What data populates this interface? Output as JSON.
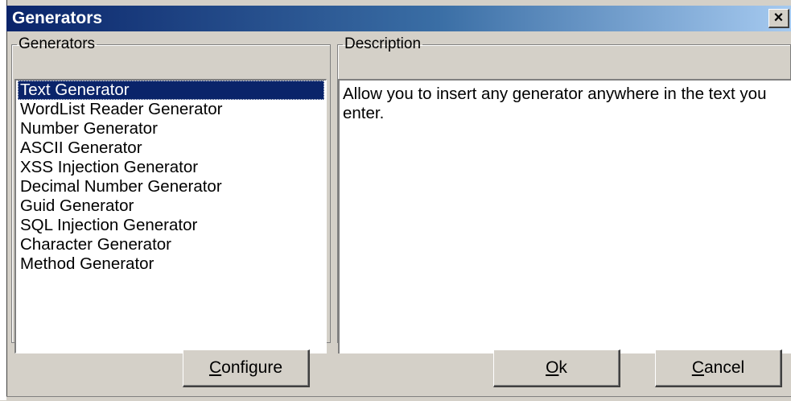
{
  "window": {
    "title": "Generators",
    "close_glyph": "×",
    "close_icon": "close-icon"
  },
  "generators_group": {
    "legend": "Generators",
    "selected_index": 0,
    "items": [
      "Text Generator",
      "WordList Reader Generator",
      "Number Generator",
      "ASCII Generator",
      "XSS Injection Generator",
      "Decimal Number Generator",
      "Guid Generator",
      "SQL Injection Generator",
      "Character Generator",
      "Method Generator"
    ]
  },
  "description_group": {
    "legend": "Description",
    "text": "Allow you to insert any generator anywhere in the text you enter."
  },
  "buttons": {
    "configure": {
      "mnemonic": "C",
      "rest": "onfigure"
    },
    "ok": {
      "mnemonic": "O",
      "rest": "k"
    },
    "cancel": {
      "mnemonic": "C",
      "rest": "ancel"
    }
  },
  "colors": {
    "selection": "#0a246a",
    "titlebar_start": "#0a246a",
    "face": "#d4d0c8"
  }
}
